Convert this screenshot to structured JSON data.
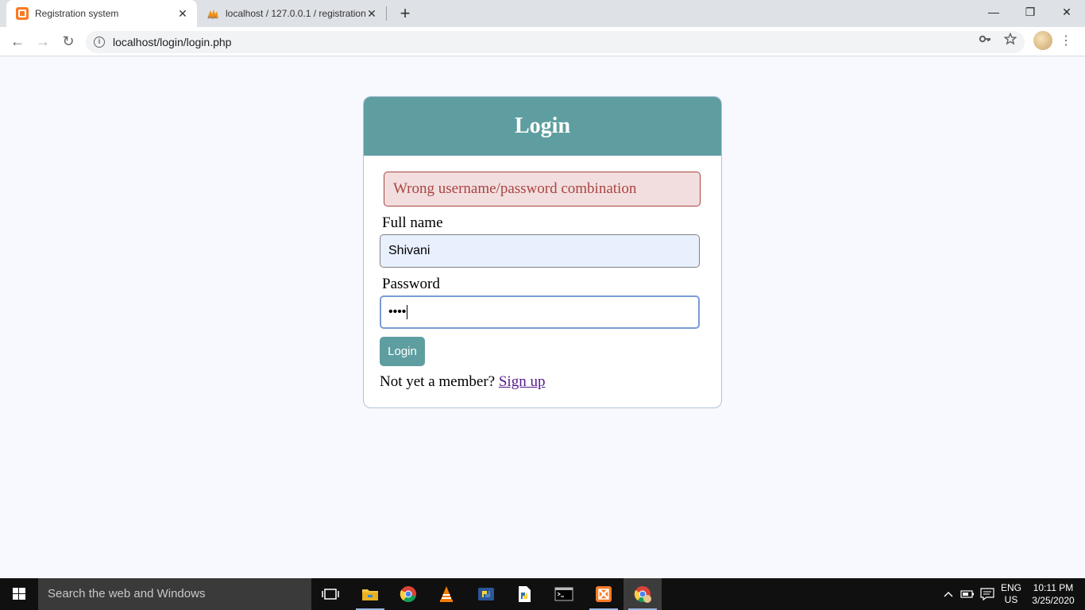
{
  "browser": {
    "tabs": [
      {
        "title": "Registration system",
        "active": true,
        "favicon": "xampp-icon"
      },
      {
        "title": "localhost / 127.0.0.1 / registration",
        "active": false,
        "favicon": "phpmyadmin-icon"
      }
    ],
    "close_glyph": "✕",
    "new_tab_glyph": "+",
    "window_controls": {
      "minimize": "—",
      "maximize": "❐",
      "close": "✕"
    },
    "url": "localhost/login/login.php",
    "nav": {
      "back": "←",
      "forward": "→",
      "reload": "↻"
    },
    "icons": {
      "key": "key-icon",
      "star": "star-icon",
      "menu": "more-vert-icon"
    }
  },
  "page": {
    "header": "Login",
    "error": "Wrong username/password combination",
    "fullname_label": "Full name",
    "fullname_value": "Shivani",
    "password_label": "Password",
    "password_mask": "••••",
    "login_button": "Login",
    "signup_prompt": "Not yet a member?",
    "signup_link": "Sign up",
    "colors": {
      "accent": "#5f9ea0",
      "error_bg": "#f2dede",
      "error_text": "#a94442",
      "page_bg": "#f8f8ff"
    }
  },
  "taskbar": {
    "search_placeholder": "Search the web and Windows",
    "language_line1": "ENG",
    "language_line2": "US",
    "time": "10:11 PM",
    "date": "3/25/2020"
  }
}
